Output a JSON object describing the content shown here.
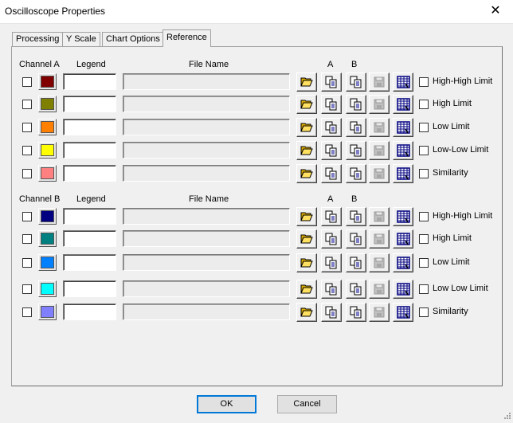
{
  "window": {
    "title": "Oscilloscope Properties",
    "close_glyph": "✕"
  },
  "tabs": [
    {
      "label": "Processing"
    },
    {
      "label": "Y Scale"
    },
    {
      "label": "Chart Options"
    },
    {
      "label": "Reference",
      "active": true
    }
  ],
  "channel_a": {
    "header": "Channel A",
    "legend_header": "Legend",
    "file_header": "File Name",
    "a_header": "A",
    "b_header": "B",
    "rows": [
      {
        "color": "#800000",
        "limit_label": "High-High Limit"
      },
      {
        "color": "#808000",
        "limit_label": "High Limit"
      },
      {
        "color": "#ff8000",
        "limit_label": "Low Limit"
      },
      {
        "color": "#ffff00",
        "limit_label": "Low-Low Limit"
      },
      {
        "color": "#ff8080",
        "limit_label": "Similarity"
      }
    ]
  },
  "channel_b": {
    "header": "Channel B",
    "legend_header": "Legend",
    "file_header": "File Name",
    "a_header": "A",
    "b_header": "B",
    "rows": [
      {
        "color": "#000080",
        "limit_label": "High-High Limit"
      },
      {
        "color": "#008080",
        "limit_label": "High Limit"
      },
      {
        "color": "#0080ff",
        "limit_label": "Low Limit"
      },
      {
        "color": "#00ffff",
        "limit_label": "Low Low Limit"
      },
      {
        "color": "#8080ff",
        "limit_label": "Similarity"
      }
    ]
  },
  "icons": {
    "open": "folder-open-icon",
    "copy_a": "copy-icon",
    "copy_b": "copy-icon",
    "save": "save-icon",
    "table": "table-icon"
  },
  "footer": {
    "ok_label": "OK",
    "cancel_label": "Cancel"
  }
}
